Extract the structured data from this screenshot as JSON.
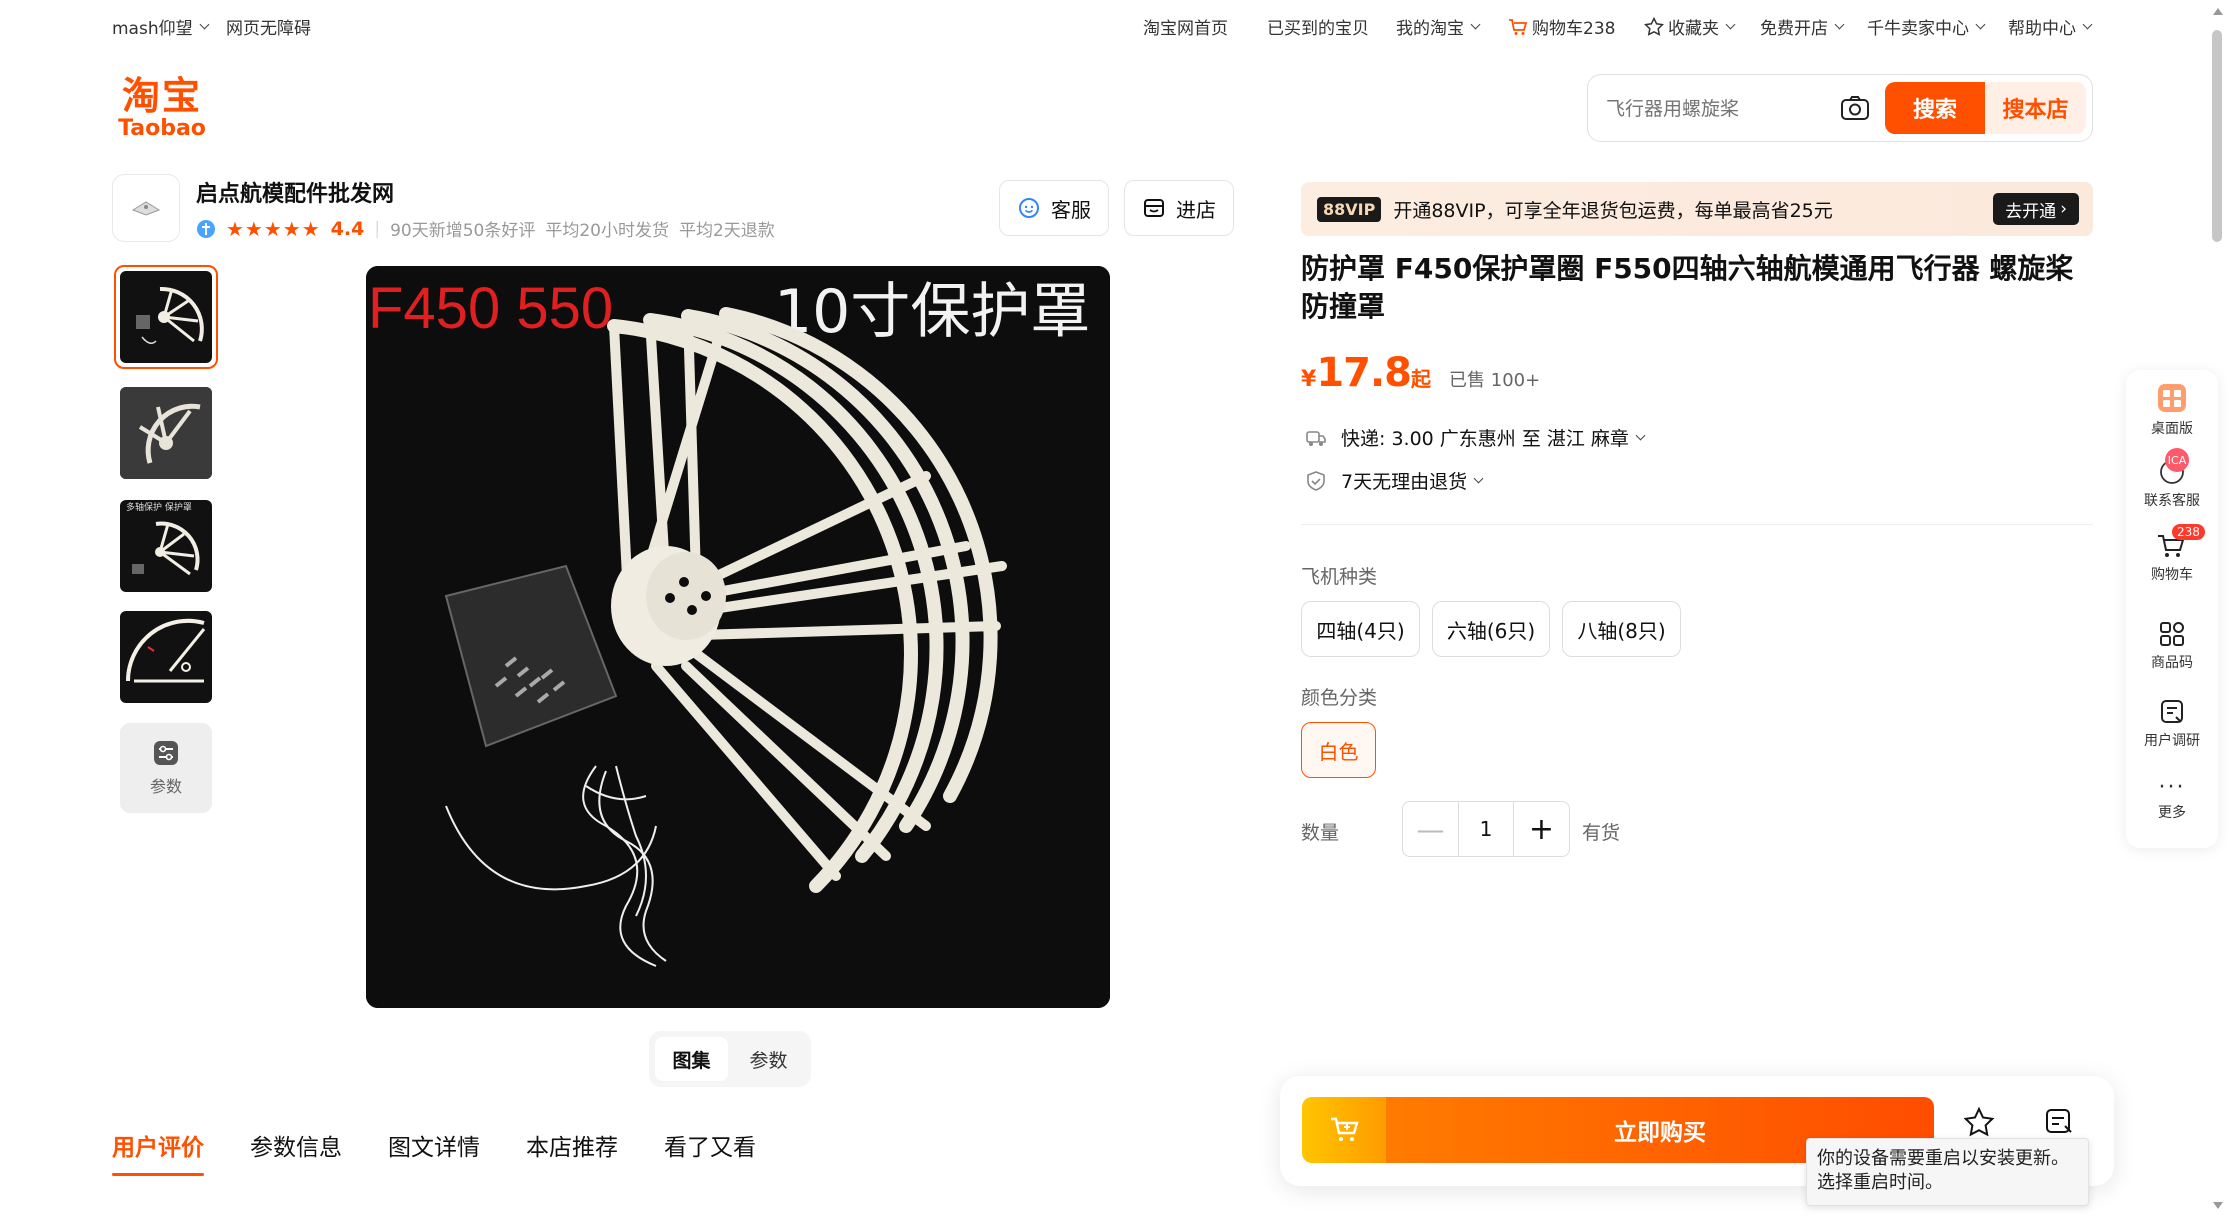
{
  "topnav": {
    "user": "mash仰望",
    "accessibility": "网页无障碍",
    "home": "淘宝网首页",
    "bought": "已买到的宝贝",
    "my_taobao": "我的淘宝",
    "cart": "购物车238",
    "favorites": "收藏夹",
    "open_shop": "免费开店",
    "seller_center": "千牛卖家中心",
    "help": "帮助中心"
  },
  "logo": {
    "cn": "淘宝",
    "en": "Taobao"
  },
  "search": {
    "placeholder": "飞行器用螺旋桨",
    "search_btn": "搜索",
    "shop_btn": "搜本店"
  },
  "shop": {
    "name": "启点航模配件批发网",
    "score": "4.4",
    "reviews": "90天新增50条好评",
    "ship_time": "平均20小时发货",
    "refund_time": "平均2天退款",
    "service_btn": "客服",
    "enter_btn": "进店"
  },
  "gallery": {
    "param_label": "参数",
    "main_text_left": "F450 550",
    "main_text_right": "10寸保护罩",
    "thumb3_text": "多轴保护 保护罩",
    "seg_gallery": "图集",
    "seg_params": "参数"
  },
  "tabs": [
    "用户评价",
    "参数信息",
    "图文详情",
    "本店推荐",
    "看了又看"
  ],
  "vip": {
    "tag": "88VIP",
    "text": "开通88VIP，可享全年退货包运费，每单最高省25元",
    "btn": "去开通"
  },
  "product": {
    "title": "防护罩 F450保护罩圈 F550四轴六轴航模通用飞行器 螺旋桨防撞罩",
    "currency": "¥",
    "price": "17.8",
    "price_suffix": "起",
    "sold": "已售 100+",
    "shipping": "快递: 3.00  广东惠州 至 湛江 麻章",
    "returns": "7天无理由退货"
  },
  "options": {
    "type_label": "飞机种类",
    "types": [
      "四轴(4只)",
      "六轴(6只)",
      "八轴(8只)"
    ],
    "color_label": "颜色分类",
    "colors": [
      "白色"
    ],
    "qty_label": "数量",
    "qty_value": "1",
    "stock": "有货"
  },
  "buybar": {
    "buy_now": "立即购买"
  },
  "sidebar": {
    "desktop": "桌面版",
    "service": "联系客服",
    "cart": "购物车",
    "cart_count": "238",
    "qrcode": "商品码",
    "survey": "用户调研",
    "more": "更多"
  },
  "toast": {
    "line1": "你的设备需要重启以安装更新。",
    "line2": "选择重启时间。"
  },
  "colors": {
    "accent": "#ff5000",
    "vip_bg": "#fdece0"
  }
}
